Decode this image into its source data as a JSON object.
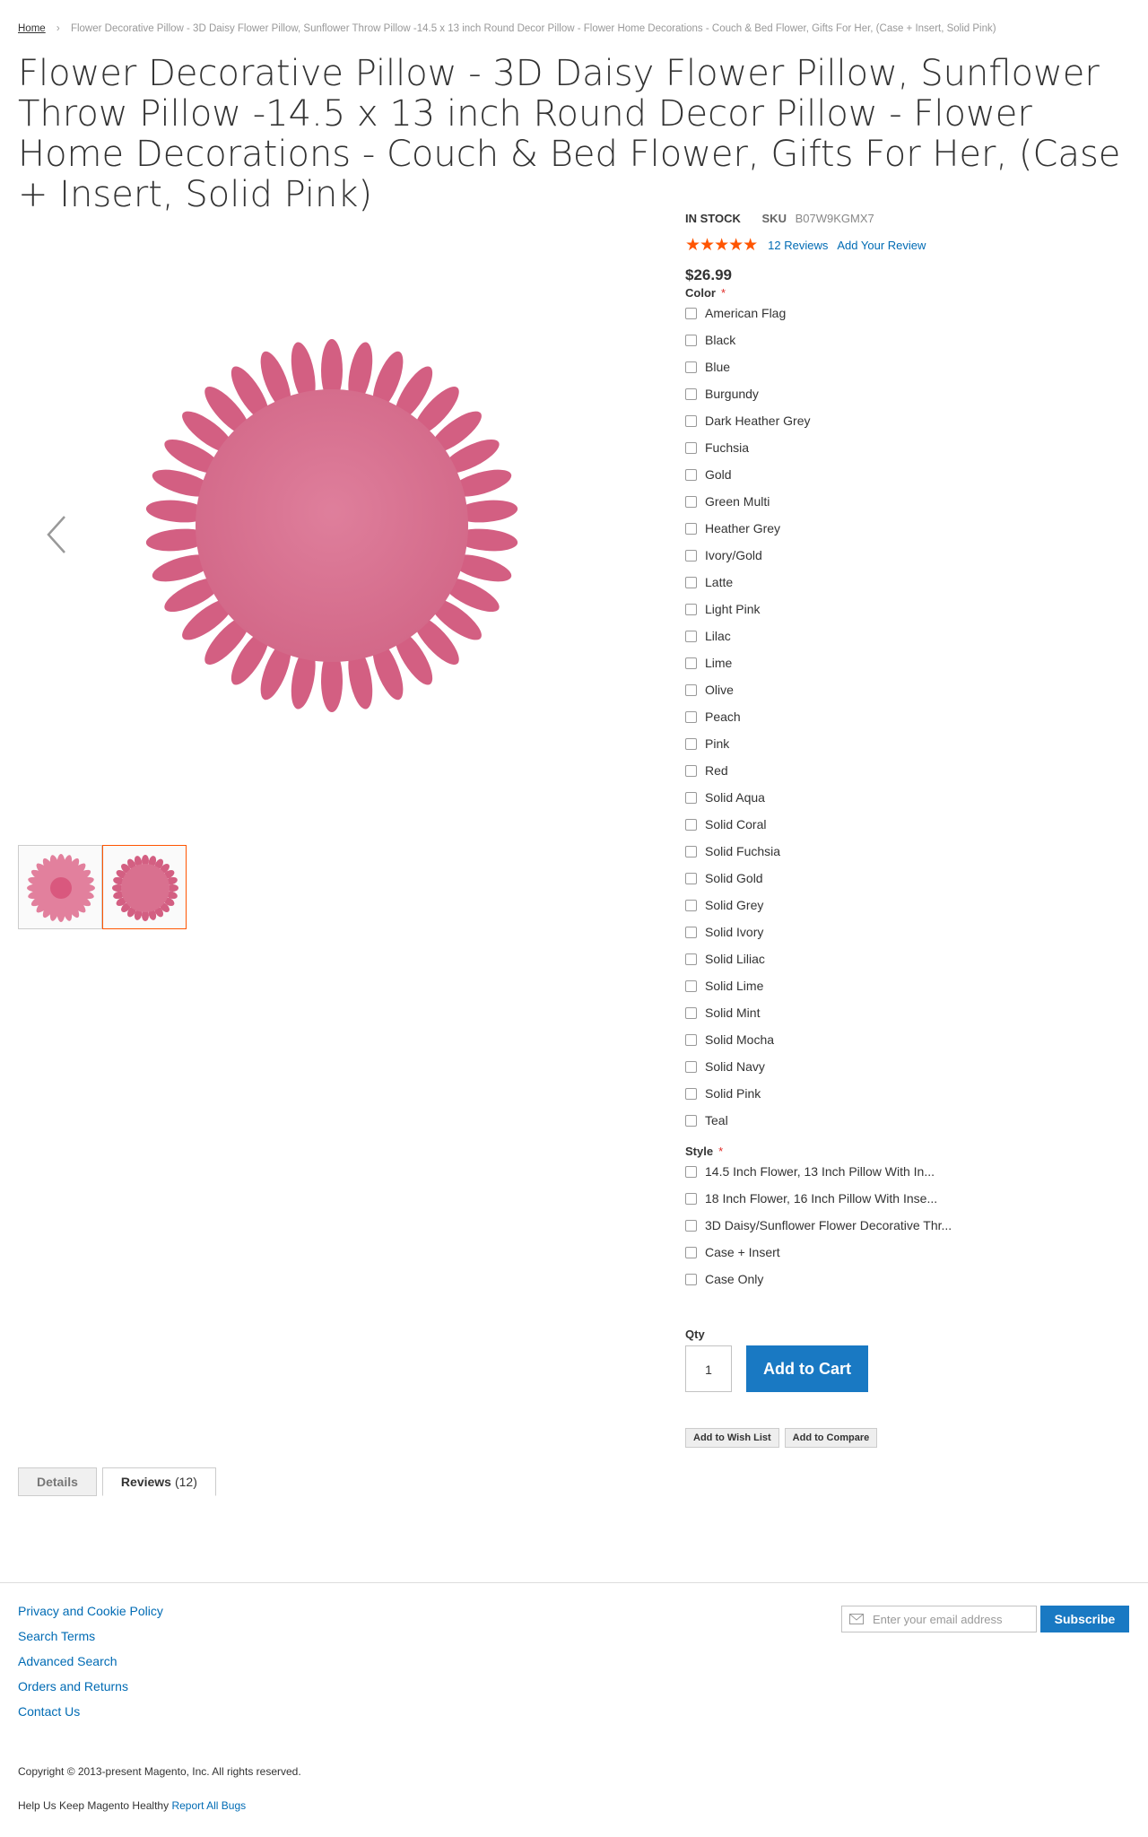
{
  "breadcrumb": {
    "home": "Home",
    "separator": "›",
    "current": "Flower Decorative Pillow - 3D Daisy Flower Pillow, Sunflower Throw Pillow -14.5 x 13 inch Round Decor Pillow - Flower Home Decorations - Couch & Bed Flower, Gifts For Her, (Case + Insert, Solid Pink)"
  },
  "product": {
    "title": "Flower Decorative Pillow - 3D Daisy Flower Pillow, Sunflower Throw Pillow -14.5 x 13 inch Round Decor Pillow - Flower Home Decorations - Couch & Bed Flower, Gifts For Her, (Case + Insert, Solid Pink)",
    "stock": "IN STOCK",
    "sku_label": "SKU",
    "sku": "B07W9KGMX7",
    "stars": "★★★★★",
    "rating_fraction": 0.9,
    "reviews_link": "12  Reviews",
    "add_review": "Add Your Review",
    "price": "$26.99"
  },
  "gallery": {
    "prev_arrow": "‹",
    "pillow_color": "#d96b8a"
  },
  "options": {
    "color_label": "Color",
    "required_mark": "*",
    "colors": [
      "American Flag",
      "Black",
      "Blue",
      "Burgundy",
      "Dark Heather Grey",
      "Fuchsia",
      "Gold",
      "Green Multi",
      "Heather Grey",
      "Ivory/Gold",
      "Latte",
      "Light Pink",
      "Lilac",
      "Lime",
      "Olive",
      "Peach",
      "Pink",
      "Red",
      "Solid Aqua",
      "Solid Coral",
      "Solid Fuchsia",
      "Solid Gold",
      "Solid Grey",
      "Solid Ivory",
      "Solid Liliac",
      "Solid Lime",
      "Solid Mint",
      "Solid Mocha",
      "Solid Navy",
      "Solid Pink",
      "Teal"
    ],
    "style_label": "Style",
    "styles": [
      "14.5 Inch Flower, 13 Inch Pillow With In...",
      "18 Inch Flower, 16 Inch Pillow With Inse...",
      "3D Daisy/Sunflower Flower Decorative Thr...",
      "Case + Insert",
      "Case Only"
    ]
  },
  "cart": {
    "qty_label": "Qty",
    "qty_value": "1",
    "add_to_cart": "Add to Cart",
    "wishlist": "Add to Wish List",
    "compare": "Add to Compare"
  },
  "tabs": {
    "details": "Details",
    "reviews": "Reviews",
    "reviews_count": "(12)"
  },
  "footer": {
    "links": [
      "Privacy and Cookie Policy",
      "Search Terms",
      "Advanced Search",
      "Orders and Returns",
      "Contact Us"
    ],
    "newsletter_placeholder": "Enter your email address",
    "subscribe": "Subscribe",
    "copyright": "Copyright © 2013-present Magento, Inc. All rights reserved.",
    "help_text": "Help Us Keep Magento Healthy",
    "report_bugs": "Report All Bugs"
  },
  "colors": {
    "accent": "#1979c3",
    "link": "#006bb4",
    "star": "#ff5501",
    "required": "#e02b27"
  }
}
